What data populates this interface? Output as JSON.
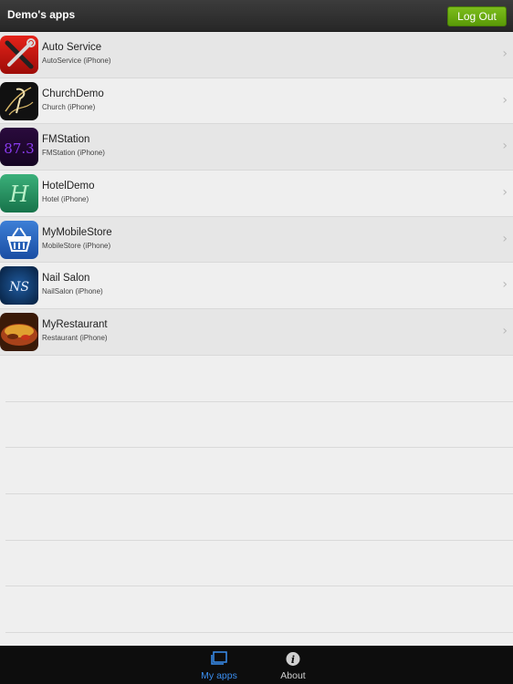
{
  "navbar": {
    "title": "Demo's apps",
    "logout_label": "Log Out"
  },
  "apps": [
    {
      "name": "Auto Service",
      "subtitle": "AutoService (iPhone)",
      "icon": "tools-icon"
    },
    {
      "name": "ChurchDemo",
      "subtitle": "Church (iPhone)",
      "icon": "church-logo-icon"
    },
    {
      "name": "FMStation",
      "subtitle": "FMStation (iPhone)",
      "icon": "fm-station-icon",
      "icon_text": "87.3"
    },
    {
      "name": "HotelDemo",
      "subtitle": "Hotel (iPhone)",
      "icon": "hotel-logo-icon",
      "icon_text": "H"
    },
    {
      "name": "MyMobileStore",
      "subtitle": "MobileStore (iPhone)",
      "icon": "shopping-basket-icon"
    },
    {
      "name": "Nail Salon",
      "subtitle": "NailSalon (iPhone)",
      "icon": "nail-salon-logo-icon",
      "icon_text": "NS"
    },
    {
      "name": "MyRestaurant",
      "subtitle": "Restaurant (iPhone)",
      "icon": "restaurant-food-icon"
    }
  ],
  "tabbar": {
    "tabs": [
      {
        "label": "My apps",
        "icon": "my-apps-icon",
        "active": true
      },
      {
        "label": "About",
        "icon": "info-icon",
        "active": false
      }
    ]
  },
  "colors": {
    "active_tab": "#3a8ef0",
    "logout_button": "#6aab12"
  }
}
